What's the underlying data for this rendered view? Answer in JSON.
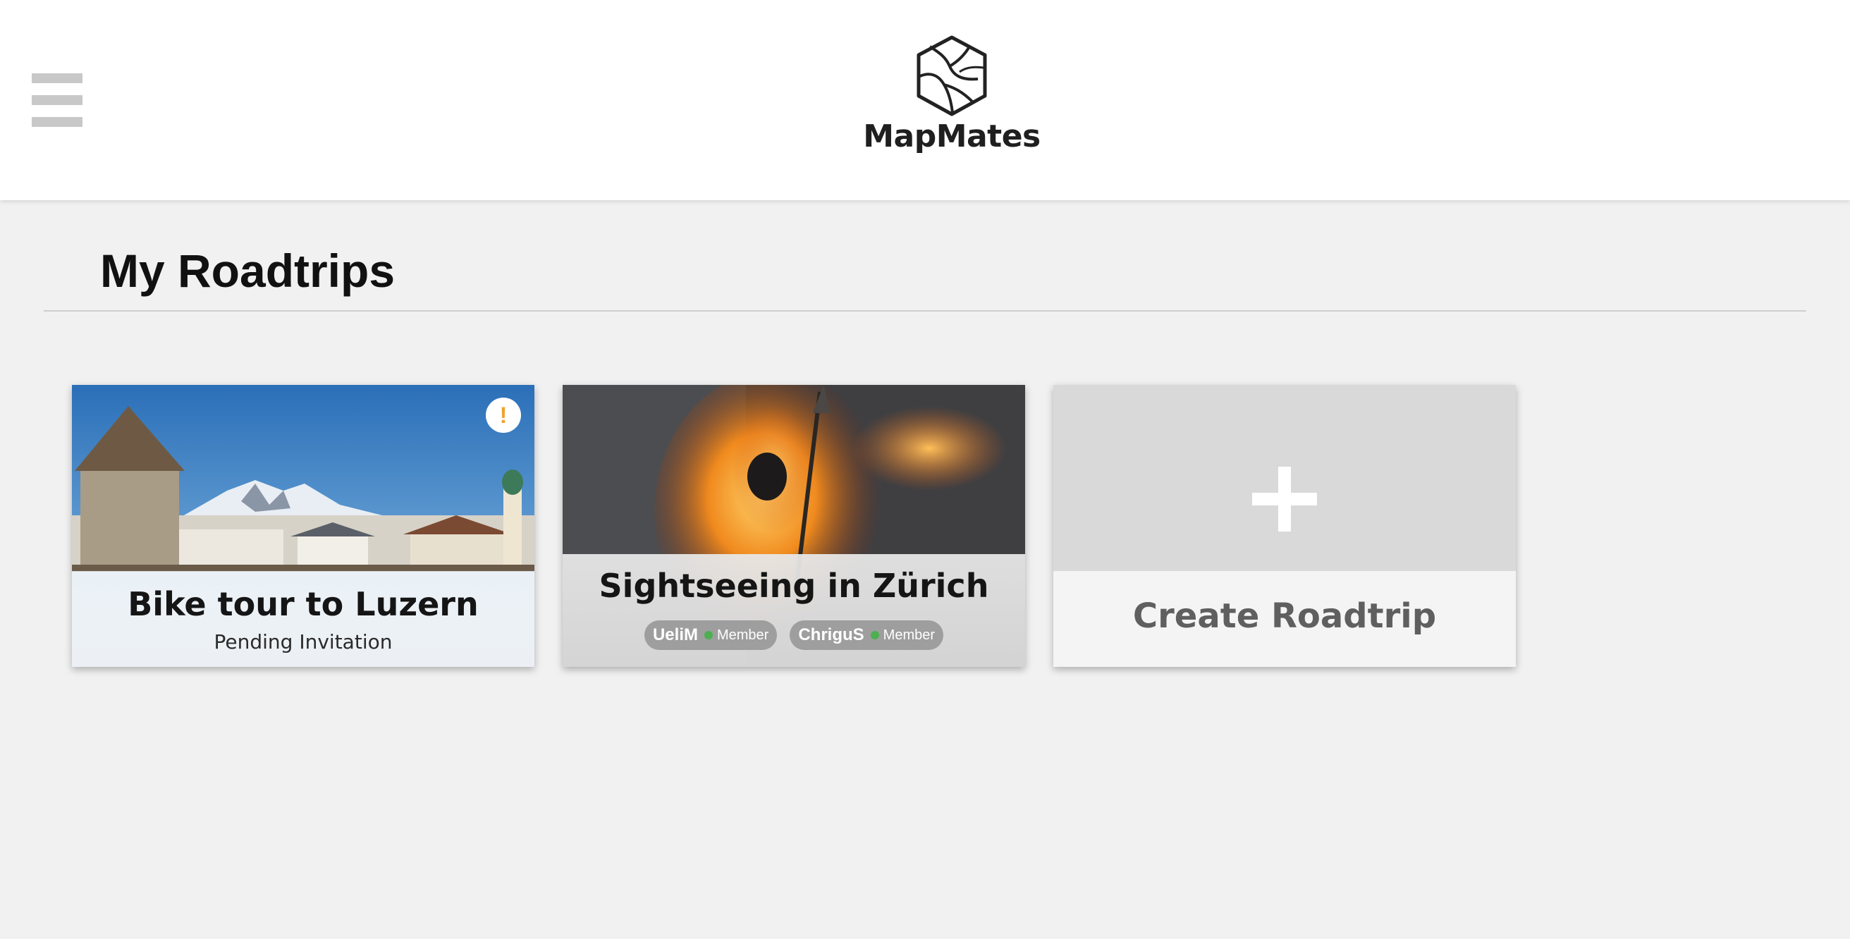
{
  "app": {
    "name": "MapMates"
  },
  "header": {
    "menu_icon": "hamburger-menu-icon",
    "logo_icon": "map-hexagon-logo-icon"
  },
  "page": {
    "title": "My Roadtrips"
  },
  "roadtrips": [
    {
      "title": "Bike tour to Luzern",
      "status": "Pending Invitation",
      "badge": "!",
      "badge_color": "#f0a22e"
    },
    {
      "title": "Sightseeing in Zürich",
      "members": [
        {
          "name": "UeliM",
          "role": "Member"
        },
        {
          "name": "ChriguS",
          "role": "Member"
        }
      ],
      "member_status_color": "#4caf50"
    }
  ],
  "create_card": {
    "label": "Create Roadtrip",
    "icon": "plus-icon"
  },
  "colors": {
    "background": "#f1f1f1",
    "header": "#ffffff",
    "alert": "#f0a22e",
    "online": "#4caf50"
  }
}
